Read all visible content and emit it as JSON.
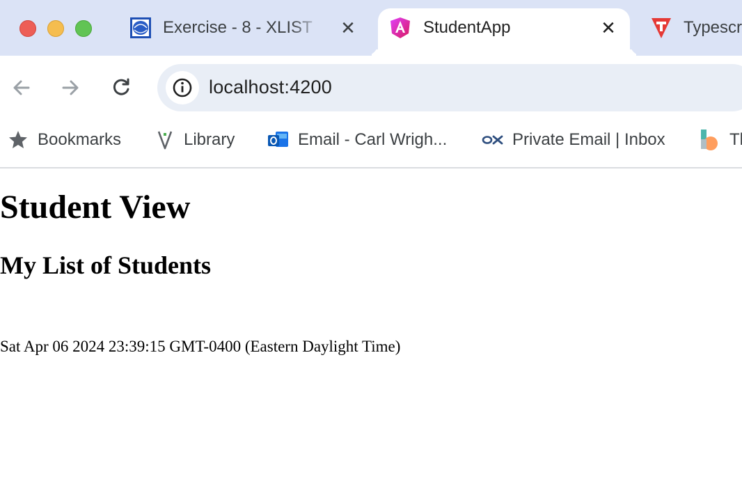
{
  "browser": {
    "tabs": [
      {
        "title": "Exercise - 8 - XLIST",
        "favicon": "georgetown-icon",
        "active": false
      },
      {
        "title": "StudentApp",
        "favicon": "angular-icon",
        "active": true
      },
      {
        "title": "Typescr",
        "favicon": "typescript-icon",
        "active": false
      }
    ],
    "address": "localhost:4200",
    "bookmarks": [
      {
        "label": "Bookmarks",
        "icon": "star-icon"
      },
      {
        "label": "Library",
        "icon": "library-icon"
      },
      {
        "label": "Email - Carl Wrigh...",
        "icon": "outlook-icon"
      },
      {
        "label": "Private Email | Inbox",
        "icon": "ox-mail-icon"
      },
      {
        "label": "Tl",
        "icon": "bookmark-app-icon"
      }
    ]
  },
  "page": {
    "title": "Student View",
    "subtitle": "My List of Students",
    "date": "Sat Apr 06 2024 23:39:15 GMT-0400 (Eastern Daylight Time)"
  },
  "colors": {
    "tabstrip": "#dbe3f6",
    "omnibox": "#e9eef6",
    "angular_magenta": "#d81b60",
    "typescript_red": "#e53935"
  }
}
